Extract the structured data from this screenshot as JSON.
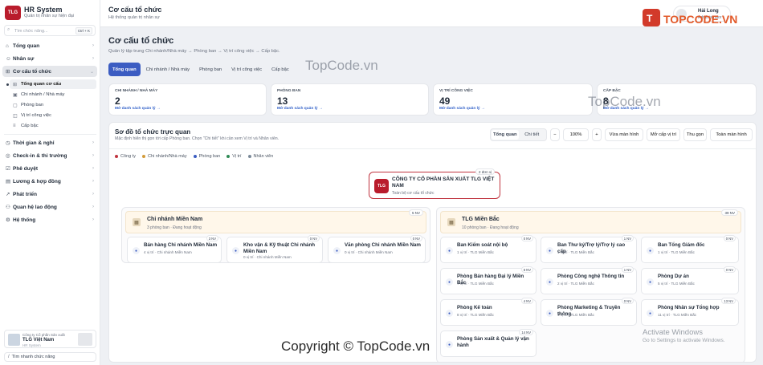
{
  "app": {
    "logo_text": "TLG",
    "title": "HR System",
    "subtitle": "Quản trị nhân sự hiện đại"
  },
  "sidebar": {
    "search_placeholder": "Tìm chức năng...",
    "search_shortcut": "Ctrl + K",
    "items": [
      {
        "label": "Tổng quan",
        "icon": "home-icon",
        "glyph": "⌂"
      },
      {
        "label": "Nhân sự",
        "icon": "users-icon",
        "glyph": "👥"
      },
      {
        "label": "Cơ cấu tổ chức",
        "icon": "org-icon",
        "glyph": "⊞"
      },
      {
        "label": "Thời gian & nghỉ",
        "icon": "clock-icon",
        "glyph": "◷"
      },
      {
        "label": "Check-in & thi trường",
        "icon": "pin-icon",
        "glyph": "◎"
      },
      {
        "label": "Phê duyệt",
        "icon": "check-icon",
        "glyph": "☑"
      },
      {
        "label": "Lương & hợp đồng",
        "icon": "money-icon",
        "glyph": "▤"
      },
      {
        "label": "Phát triển",
        "icon": "growth-icon",
        "glyph": "↗"
      },
      {
        "label": "Quan hệ lao động",
        "icon": "handshake-icon",
        "glyph": "⚇"
      },
      {
        "label": "Hệ thống",
        "icon": "gear-icon",
        "glyph": "⚙"
      }
    ],
    "subitems": [
      {
        "label": "Tổng quan cơ cấu",
        "glyph": "⊞"
      },
      {
        "label": "Chi nhánh / Nhà máy",
        "glyph": "▣"
      },
      {
        "label": "Phòng ban",
        "glyph": "▢"
      },
      {
        "label": "Vị trí công việc",
        "glyph": "◫"
      },
      {
        "label": "Cấp bậc",
        "glyph": "≡"
      }
    ],
    "company": {
      "pre": "Công ty Cổ phần Sản xuất",
      "name": "TLG Việt Nam",
      "sub": "HR System"
    },
    "footer_search": "Tìm nhanh chức năng"
  },
  "topbar": {
    "title": "Cơ cấu tổ chức",
    "subtitle": "Hệ thống quản trị nhân sự",
    "user_name": "Hải Long",
    "user_role": "Administrator"
  },
  "page": {
    "title": "Cơ cấu tổ chức",
    "desc": "Quản lý tập trung Chi nhánh/Nhà máy → Phòng ban → Vị trí công việc → Cấp bậc.",
    "tabs": [
      "Tổng quan",
      "Chi nhánh / Nhà máy",
      "Phòng ban",
      "Vị trí công việc",
      "Cấp bậc"
    ]
  },
  "stats": [
    {
      "label": "CHI NHÁNH / NHÀ MÁY",
      "value": "2",
      "link": "Mở danh sách quản lý →"
    },
    {
      "label": "PHÒNG BAN",
      "value": "13",
      "link": "Mở danh sách quản lý →"
    },
    {
      "label": "VỊ TRÍ CÔNG VIỆC",
      "value": "49",
      "link": "Mở danh sách quản lý →"
    },
    {
      "label": "CẤP BẬC",
      "value": "8",
      "link": "Mở danh sách quản lý →"
    }
  ],
  "chart": {
    "title": "Sơ đồ tổ chức trực quan",
    "desc": "Mặc định hiển thị gọn tới cấp Phòng ban. Chọn \"Chi tiết\" khi cần xem Vị trí và Nhân viên.",
    "seg": [
      "Tổng quan",
      "Chi tiết"
    ],
    "zoom_out": "−",
    "zoom": "100%",
    "zoom_in": "+",
    "btn_fit": "Vừa màn hình",
    "btn_pos": "Mở cấp vị trí",
    "btn_collapse": "Thu gọn",
    "btn_full": "Toàn màn hình",
    "legend": [
      {
        "label": "Công ty",
        "color": "#c0343f"
      },
      {
        "label": "Chi nhánh/Nhà máy",
        "color": "#d39b3a"
      },
      {
        "label": "Phòng ban",
        "color": "#3b5cc2"
      },
      {
        "label": "Vị trí",
        "color": "#2f8a55"
      },
      {
        "label": "Nhân viên",
        "color": "#7b8a99"
      }
    ],
    "root": {
      "logo": "TLG",
      "name": "CÔNG TY CỔ PHẦN SẢN XUẤT TLG VIỆT NAM",
      "sub": "Toàn bộ cơ cấu tổ chức",
      "tag": "2 đơn vị"
    },
    "branches": [
      {
        "name": "Chi nhánh Miền Nam",
        "sub": "3 phòng ban · Đang hoạt động",
        "tag": "5 NV",
        "depts": [
          {
            "name": "Bán hàng Chi nhánh Miền Nam",
            "sub": "4 vị trí · Chi nhánh Miền Nam",
            "tag": "3 NV"
          },
          {
            "name": "Kho vận & Kỹ thuật Chi nhánh Miền Nam",
            "sub": "0 vị trí · Chi nhánh Miền Nam",
            "tag": "0 NV"
          },
          {
            "name": "Văn phòng Chi nhánh Miền Nam",
            "sub": "0 vị trí · Chi nhánh Miền Nam",
            "tag": "0 NV"
          }
        ]
      },
      {
        "name": "TLG Miền Bắc",
        "sub": "10 phòng ban · Đang hoạt động",
        "tag": "39 NV",
        "depts": [
          {
            "name": "Ban Kiểm soát nội bộ",
            "sub": "1 vị trí · TLG Miền Bắc",
            "tag": "0 NV"
          },
          {
            "name": "Ban Thư ký/Trợ lý/Trợ lý cao cấp",
            "sub": "1 vị trí · TLG Miền Bắc",
            "tag": "1 NV"
          },
          {
            "name": "Ban Tổng Giám đốc",
            "sub": "1 vị trí · TLG Miền Bắc",
            "tag": "0 NV"
          },
          {
            "name": "Phòng Bán hàng Đại lý Miền Bắc",
            "sub": "7 vị trí · TLG Miền Bắc",
            "tag": "6 NV"
          },
          {
            "name": "Phòng Công nghệ Thông tin",
            "sub": "2 vị trí · TLG Miền Bắc",
            "tag": "1 NV"
          },
          {
            "name": "Phòng Dự án",
            "sub": "5 vị trí · TLG Miền Bắc",
            "tag": "0 NV"
          },
          {
            "name": "Phòng Kế toán",
            "sub": "8 vị trí · TLG Miền Bắc",
            "tag": "4 NV"
          },
          {
            "name": "Phòng Marketing & Truyền thông",
            "sub": "4 vị trí · TLG Miền Bắc",
            "tag": "0 NV"
          },
          {
            "name": "Phòng Nhân sự Tổng hợp",
            "sub": "11 vị trí · TLG Miền Bắc",
            "tag": "13 NV"
          },
          {
            "name": "Phòng Sản xuất & Quản lý vận hành",
            "sub": "",
            "tag": "14 NV"
          }
        ]
      }
    ]
  },
  "overlays": {
    "watermark_logo": "TOPCODE.VN",
    "tc1": "TopCode.vn",
    "tc2": "TopCode.vn",
    "copyright": "Copyright © TopCode.vn",
    "win1": "Activate Windows",
    "win2": "Go to Settings to activate Windows."
  }
}
